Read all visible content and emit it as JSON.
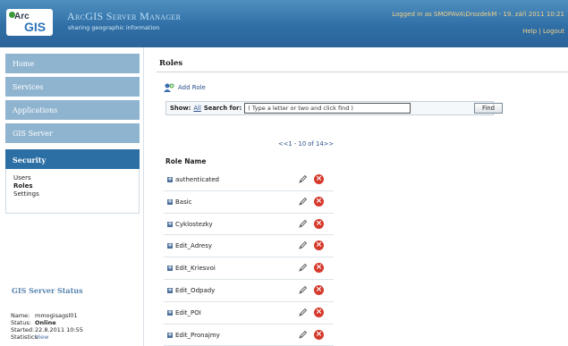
{
  "header": {
    "logo_top": "Arc",
    "logo_bottom": "GIS",
    "title": "ArcGIS Server Manager",
    "subtitle": "sharing geographic information",
    "login_info": "Logged in as SMOPAVA\\DrozdekM - 19. září 2011 10:21",
    "help_label": "Help",
    "separator": "|",
    "logout_label": "Logout"
  },
  "sidebar": {
    "items": [
      {
        "label": "Home"
      },
      {
        "label": "Services"
      },
      {
        "label": "Applications"
      },
      {
        "label": "GIS Server"
      },
      {
        "label": "Security"
      }
    ],
    "subitems": [
      {
        "label": "Users"
      },
      {
        "label": "Roles"
      },
      {
        "label": "Settings"
      }
    ],
    "status": {
      "title": "GIS Server Status",
      "rows": [
        {
          "key": "Name:",
          "value": "mmogisagsl01"
        },
        {
          "key": "Status:",
          "value": "Online"
        },
        {
          "key": "Started:",
          "value": "22.8.2011 10:55"
        },
        {
          "key": "Statistics:",
          "value": "View"
        }
      ]
    }
  },
  "main": {
    "title": "Roles",
    "add_role_label": "Add Role",
    "search": {
      "show_label": "Show:",
      "all_label": "All",
      "search_for_label": "Search for:",
      "input_value": "( Type a letter or two and click find )",
      "find_label": "Find"
    },
    "pager": {
      "prev": "<<",
      "range": "1 - 10 of 14",
      "next": ">>"
    },
    "column_header": "Role Name",
    "roles": [
      {
        "name": "authenticated"
      },
      {
        "name": "Basic"
      },
      {
        "name": "Cyklostezky"
      },
      {
        "name": "Edit_Adresy"
      },
      {
        "name": "Edit_Kriesvoi"
      },
      {
        "name": "Edit_Odpady"
      },
      {
        "name": "Edit_POI"
      },
      {
        "name": "Edit_Pronajmy"
      }
    ]
  },
  "colors": {
    "header_blue": "#2f6fa6",
    "nav_inactive": "#8fb4cf",
    "nav_active": "#2c6fa4",
    "delete_red": "#d53a2c",
    "header_text": "#f0d08a"
  }
}
